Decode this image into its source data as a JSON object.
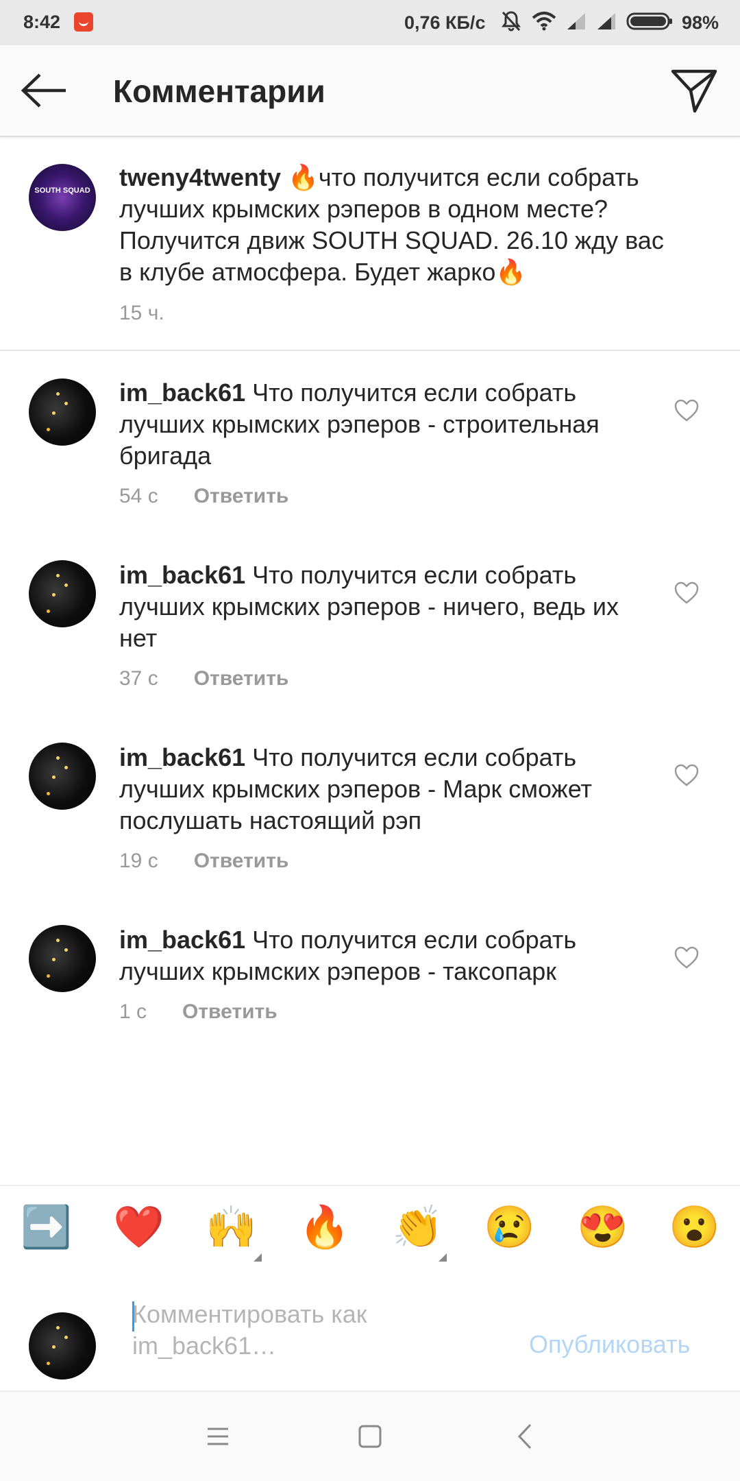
{
  "status_bar": {
    "time": "8:42",
    "network_speed": "0,76 КБ/с",
    "battery": "98%"
  },
  "header": {
    "title": "Комментарии"
  },
  "caption": {
    "username": "tweny4twenty",
    "text_emoji_start": "🔥",
    "text": "что получится если собрать лучших крымских рэперов в одном месте? Получится движ SOUTH SQUAD. 26.10 жду вас в клубе атмосфера. Будет жарко",
    "text_emoji_end": "🔥",
    "time": "15 ч.",
    "avatar_text": "SOUTH SQUAD"
  },
  "comments": [
    {
      "username": "im_back61",
      "text": "Что получится если собрать лучших крымских рэперов - строительная бригада",
      "time": "54 с",
      "reply_label": "Ответить"
    },
    {
      "username": "im_back61",
      "text": "Что получится если собрать лучших крымских рэперов - ничего, ведь их нет",
      "time": "37 с",
      "reply_label": "Ответить"
    },
    {
      "username": "im_back61",
      "text": "Что получится если собрать лучших крымских рэперов - Марк сможет послушать настоящий рэп",
      "time": "19 с",
      "reply_label": "Ответить"
    },
    {
      "username": "im_back61",
      "text": "Что получится если собрать лучших крымских рэперов - таксопарк",
      "time": "1 с",
      "reply_label": "Ответить"
    }
  ],
  "emoji_bar": [
    "➡️",
    "❤️",
    "🙌",
    "🔥",
    "👏",
    "😢",
    "😍",
    "😮"
  ],
  "comment_input": {
    "placeholder_line1": "Комментировать как",
    "placeholder_line2": "im_back61…",
    "publish_label": "Опубликовать"
  },
  "colors": {
    "text": "#262626",
    "secondary": "#999999",
    "link_disabled": "#b3d6f7",
    "caret": "#3897f0"
  }
}
